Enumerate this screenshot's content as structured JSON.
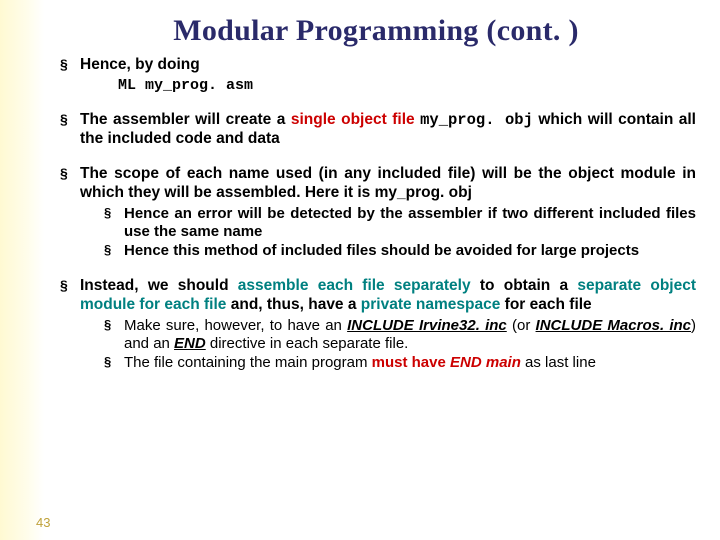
{
  "title": "Modular Programming (cont. )",
  "bullets": {
    "b1": "Hence, by doing",
    "b1_code": "ML my_prog. asm",
    "b2_pre": "The assembler will create a ",
    "b2_red": "single object file ",
    "b2_code": "my_prog. obj",
    "b2_post": " which will contain all the included code and data",
    "b3_main": "The scope of each name used (in any included file) will be the object module in which they will be assembled. Here it is my_prog. obj",
    "b3_s1": "Hence an error will be detected by the assembler if two different included files use the same name",
    "b3_s2": "Hence this method of included files should be avoided for large projects",
    "b4_pre": "Instead, we should ",
    "b4_teal1": "assemble each file separately",
    "b4_mid1": " to obtain a ",
    "b4_teal2": "separate object module for each file",
    "b4_mid2": " and, thus, have a ",
    "b4_teal3": "private namespace",
    "b4_post": " for each file",
    "b4_s1_pre": "Make sure, however, to have an ",
    "b4_s1_inc1": "INCLUDE Irvine32. inc",
    "b4_s1_mid": " (or ",
    "b4_s1_inc2": "INCLUDE Macros. inc",
    "b4_s1_close": ") and an ",
    "b4_s1_end": "END",
    "b4_s1_post": " directive in each separate file.",
    "b4_s2_pre": "The file containing the main program ",
    "b4_s2_red": "must have ",
    "b4_s2_endmain": "END main",
    "b4_s2_post": " as last line"
  },
  "page_number": "43"
}
